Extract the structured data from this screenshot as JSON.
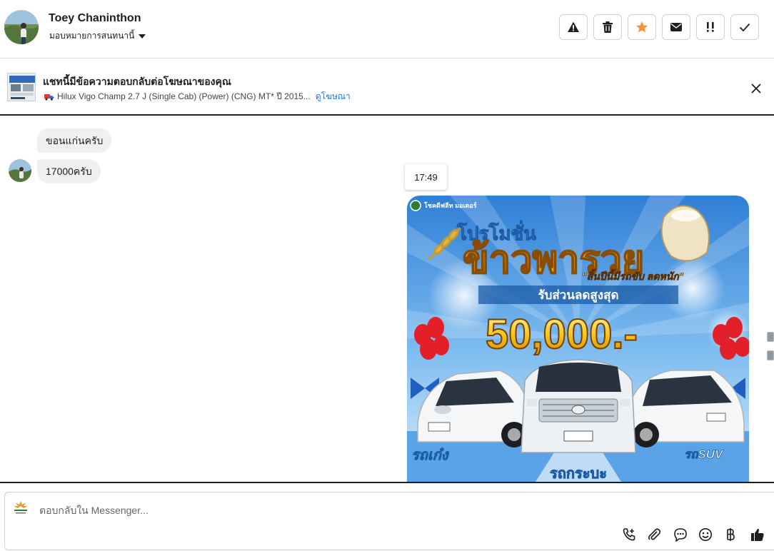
{
  "header": {
    "contact_name": "Toey Chaninthon",
    "assign_label": "มอบหมายการสนทนานี้",
    "actions": [
      {
        "name": "report-spam",
        "icon": "warning-icon"
      },
      {
        "name": "delete",
        "icon": "trash-icon"
      },
      {
        "name": "star",
        "icon": "star-icon",
        "color": "#f7923b"
      },
      {
        "name": "mark-unread",
        "icon": "envelope-icon"
      },
      {
        "name": "follow-up",
        "icon": "exclamation-icon"
      },
      {
        "name": "mark-done",
        "icon": "check-icon"
      }
    ]
  },
  "banner": {
    "title": "แชทนี้มีข้อความตอบกลับต่อโฆษณาของคุณ",
    "ad_text": "Hilux Vigo Champ 2.7 J (Single Cab) (Power) (CNG) MT* ปี 2015...",
    "link_text": "ดูโฆษณา",
    "ad_icon": "truck-emoji"
  },
  "messages": {
    "incoming": [
      {
        "text": "ขอนแก่นครับ"
      },
      {
        "text": "17000ครับ"
      }
    ],
    "timestamp": "17:49",
    "promo_image": {
      "brand": "โชคดีฟลีท มอเตอร์",
      "headline_top": "โปรโมชั่น",
      "headline_main": "ข้าวพารวย",
      "tagline": "\"สิ้นปีนี้มีรถขับ ลดหนัก\"",
      "discount_label": "รับส่วนลดสูงสุด",
      "amount": "50,000.-",
      "label_left": "รถเก๋ง",
      "label_center": "รถกระบะ",
      "label_right": "รถSUV"
    }
  },
  "composer": {
    "placeholder": "ตอบกลับใน Messenger...",
    "tools": [
      "phone-plus-icon",
      "paperclip-icon",
      "chat-bubble-icon",
      "smiley-icon",
      "baht-icon",
      "thumbs-up-icon"
    ]
  },
  "colors": {
    "accent": "#1877f2",
    "bubble_bg": "#f0f0f0",
    "star": "#f7923b",
    "promo_sky": "#3d8ee0",
    "promo_gold": "#f5c81e"
  }
}
